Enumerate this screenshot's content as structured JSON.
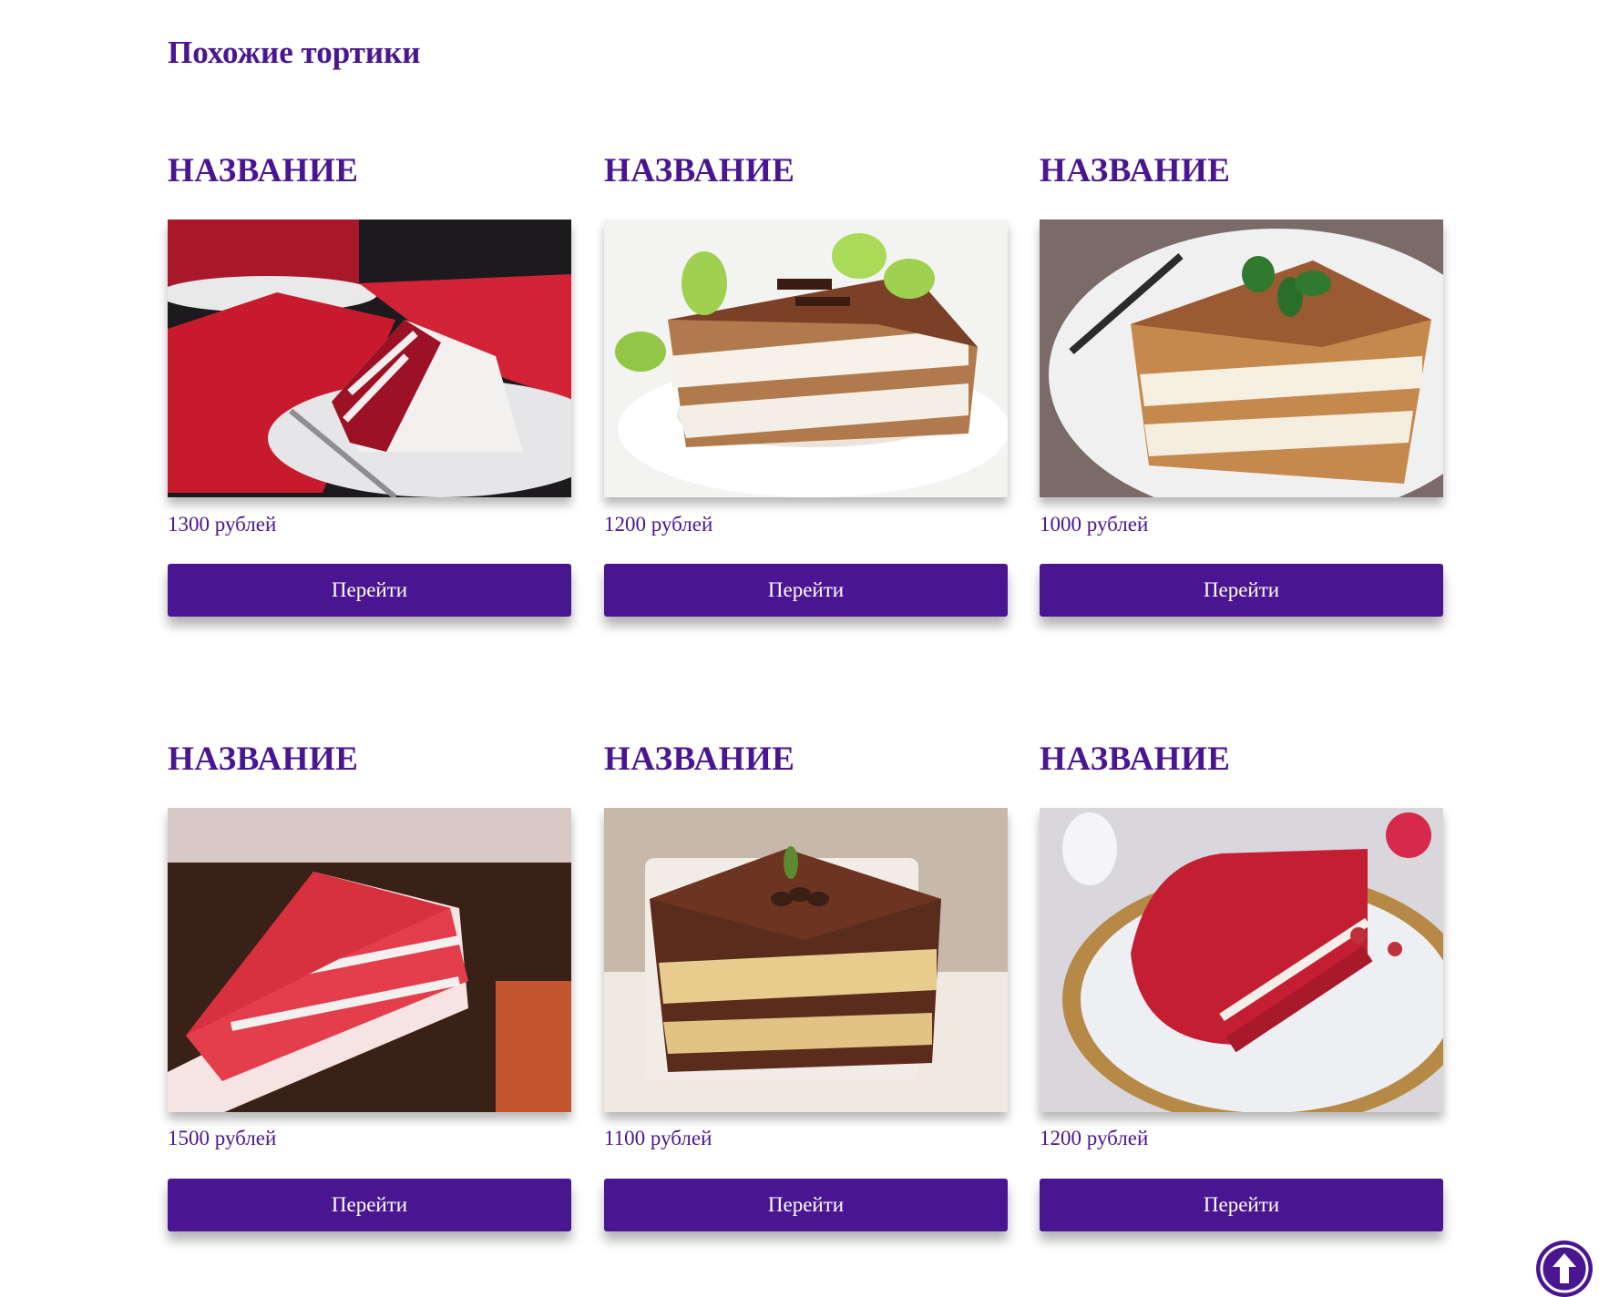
{
  "section": {
    "title": "Похожие тортики"
  },
  "cards": [
    {
      "title": "НАЗВАНИЕ",
      "image": "red-velvet-cake-slice-photo",
      "price": "1300 рублей",
      "button_label": "Перейти"
    },
    {
      "title": "НАЗВАНИЕ",
      "image": "tiramisu-with-mint-photo",
      "price": "1200 рублей",
      "button_label": "Перейти"
    },
    {
      "title": "НАЗВАНИЕ",
      "image": "tiramisu-slice-photo",
      "price": "1000 рублей",
      "button_label": "Перейти"
    },
    {
      "title": "НАЗВАНИЕ",
      "image": "red-velvet-wedge-photo",
      "price": "1500 рублей",
      "button_label": "Перейти"
    },
    {
      "title": "НАЗВАНИЕ",
      "image": "chocolate-tiramisu-square-photo",
      "price": "1100 рублей",
      "button_label": "Перейти"
    },
    {
      "title": "НАЗВАНИЕ",
      "image": "red-velvet-half-cake-photo",
      "price": "1200 рублей",
      "button_label": "Перейти"
    }
  ],
  "scroll_top": {
    "icon": "arrow-up-circle-icon"
  },
  "colors": {
    "accent": "#4a1591",
    "button_text": "#ffffff"
  }
}
